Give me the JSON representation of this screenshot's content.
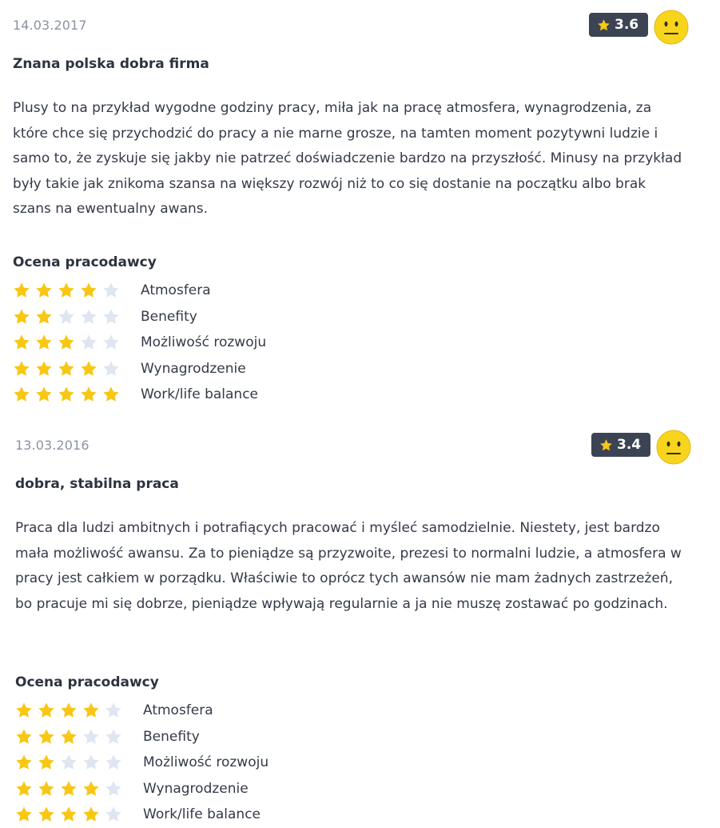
{
  "reviews": [
    {
      "date": "14.03.2017",
      "score": "3.6",
      "title": "Znana polska dobra firma",
      "body": "Plusy to na przykład wygodne godziny pracy, miła jak na pracę atmosfera, wynagrodzenia, za które chce się przychodzić do pracy a nie marne grosze, na tamten moment pozytywni ludzie i samo to, że zyskuje się jakby nie patrzeć doświadczenie bardzo na przyszłość. Minusy na przykład były takie jak znikoma szansa na większy rozwój niż to co się dostanie na początku albo brak szans na ewentualny awans.",
      "ratings_title": "Ocena pracodawcy",
      "ratings": [
        {
          "label": "Atmosfera",
          "stars": 4
        },
        {
          "label": "Benefity",
          "stars": 2
        },
        {
          "label": "Możliwość rozwoju",
          "stars": 3
        },
        {
          "label": "Wynagrodzenie",
          "stars": 4
        },
        {
          "label": "Work/life balance",
          "stars": 5
        }
      ],
      "face_icon": "neutral-face-icon"
    },
    {
      "date": "13.03.2016",
      "score": "3.4",
      "title": "dobra, stabilna praca",
      "body": "Praca dla ludzi ambitnych i potrafiących pracować i myśleć samodzielnie. Niestety, jest bardzo mała możliwość awansu. Za to pieniądze są przyzwoite, prezesi to normalni ludzie, a atmosfera w pracy jest całkiem w porządku. Właściwie to oprócz tych awansów nie mam żadnych zastrzeżeń, bo pracuje mi się dobrze, pieniądze wpływają regularnie a ja nie muszę zostawać po godzinach.",
      "ratings_title": "Ocena pracodawcy",
      "ratings": [
        {
          "label": "Atmosfera",
          "stars": 4
        },
        {
          "label": "Benefity",
          "stars": 3
        },
        {
          "label": "Możliwość rozwoju",
          "stars": 2
        },
        {
          "label": "Wynagrodzenie",
          "stars": 4
        },
        {
          "label": "Work/life balance",
          "stars": 4
        }
      ],
      "face_icon": "neutral-face-icon"
    }
  ],
  "colors": {
    "star_on": "#f8c714",
    "star_off": "#dfe6f1",
    "badge_bg": "#3c4454",
    "date_text": "#8a93a0",
    "face_fill": "#f7d51d"
  }
}
